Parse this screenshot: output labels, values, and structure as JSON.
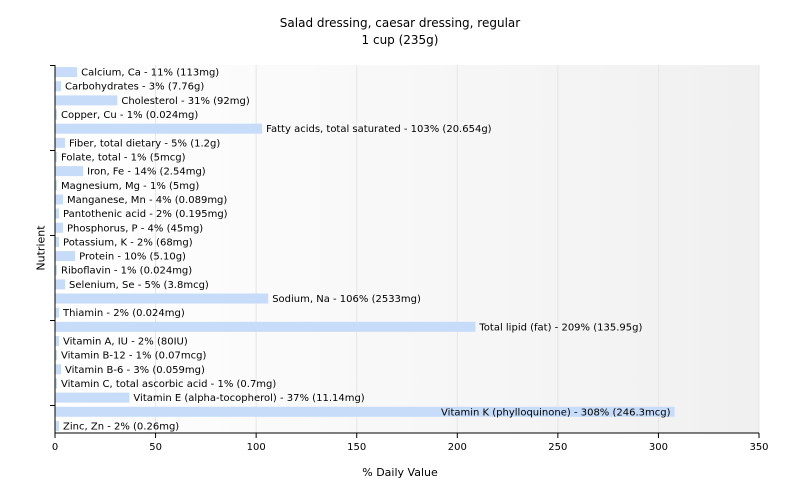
{
  "chart_data": {
    "type": "bar",
    "orientation": "horizontal",
    "title": "Salad dressing, caesar dressing, regular",
    "subtitle": "1 cup (235g)",
    "xlabel": "% Daily Value",
    "ylabel": "Nutrient",
    "xlim": [
      0,
      350
    ],
    "xticks": [
      0,
      50,
      100,
      150,
      200,
      250,
      300,
      350
    ],
    "grid": true,
    "bar_color": "#c6dcf8",
    "categories": [
      "Calcium, Ca",
      "Carbohydrates",
      "Cholesterol",
      "Copper, Cu",
      "Fatty acids, total saturated",
      "Fiber, total dietary",
      "Folate, total",
      "Iron, Fe",
      "Magnesium, Mg",
      "Manganese, Mn",
      "Pantothenic acid",
      "Phosphorus, P",
      "Potassium, K",
      "Protein",
      "Riboflavin",
      "Selenium, Se",
      "Sodium, Na",
      "Thiamin",
      "Total lipid (fat)",
      "Vitamin A, IU",
      "Vitamin B-12",
      "Vitamin B-6",
      "Vitamin C, total ascorbic acid",
      "Vitamin E (alpha-tocopherol)",
      "Vitamin K (phylloquinone)",
      "Zinc, Zn"
    ],
    "values": [
      11,
      3,
      31,
      1,
      103,
      5,
      1,
      14,
      1,
      4,
      2,
      4,
      2,
      10,
      1,
      5,
      106,
      2,
      209,
      2,
      1,
      3,
      1,
      37,
      308,
      2
    ],
    "labels": [
      "Calcium, Ca - 11% (113mg)",
      "Carbohydrates - 3% (7.76g)",
      "Cholesterol - 31% (92mg)",
      "Copper, Cu - 1% (0.024mg)",
      "Fatty acids, total saturated - 103% (20.654g)",
      "Fiber, total dietary - 5% (1.2g)",
      "Folate, total - 1% (5mcg)",
      "Iron, Fe - 14% (2.54mg)",
      "Magnesium, Mg - 1% (5mg)",
      "Manganese, Mn - 4% (0.089mg)",
      "Pantothenic acid - 2% (0.195mg)",
      "Phosphorus, P - 4% (45mg)",
      "Potassium, K - 2% (68mg)",
      "Protein - 10% (5.10g)",
      "Riboflavin - 1% (0.024mg)",
      "Selenium, Se - 5% (3.8mcg)",
      "Sodium, Na - 106% (2533mg)",
      "Thiamin - 2% (0.024mg)",
      "Total lipid (fat) - 209% (135.95g)",
      "Vitamin A, IU - 2% (80IU)",
      "Vitamin B-12 - 1% (0.07mcg)",
      "Vitamin B-6 - 3% (0.059mg)",
      "Vitamin C, total ascorbic acid - 1% (0.7mg)",
      "Vitamin E (alpha-tocopherol) - 37% (11.14mg)",
      "Vitamin K (phylloquinone) - 308% (246.3mcg)",
      "Zinc, Zn - 2% (0.26mg)"
    ]
  }
}
